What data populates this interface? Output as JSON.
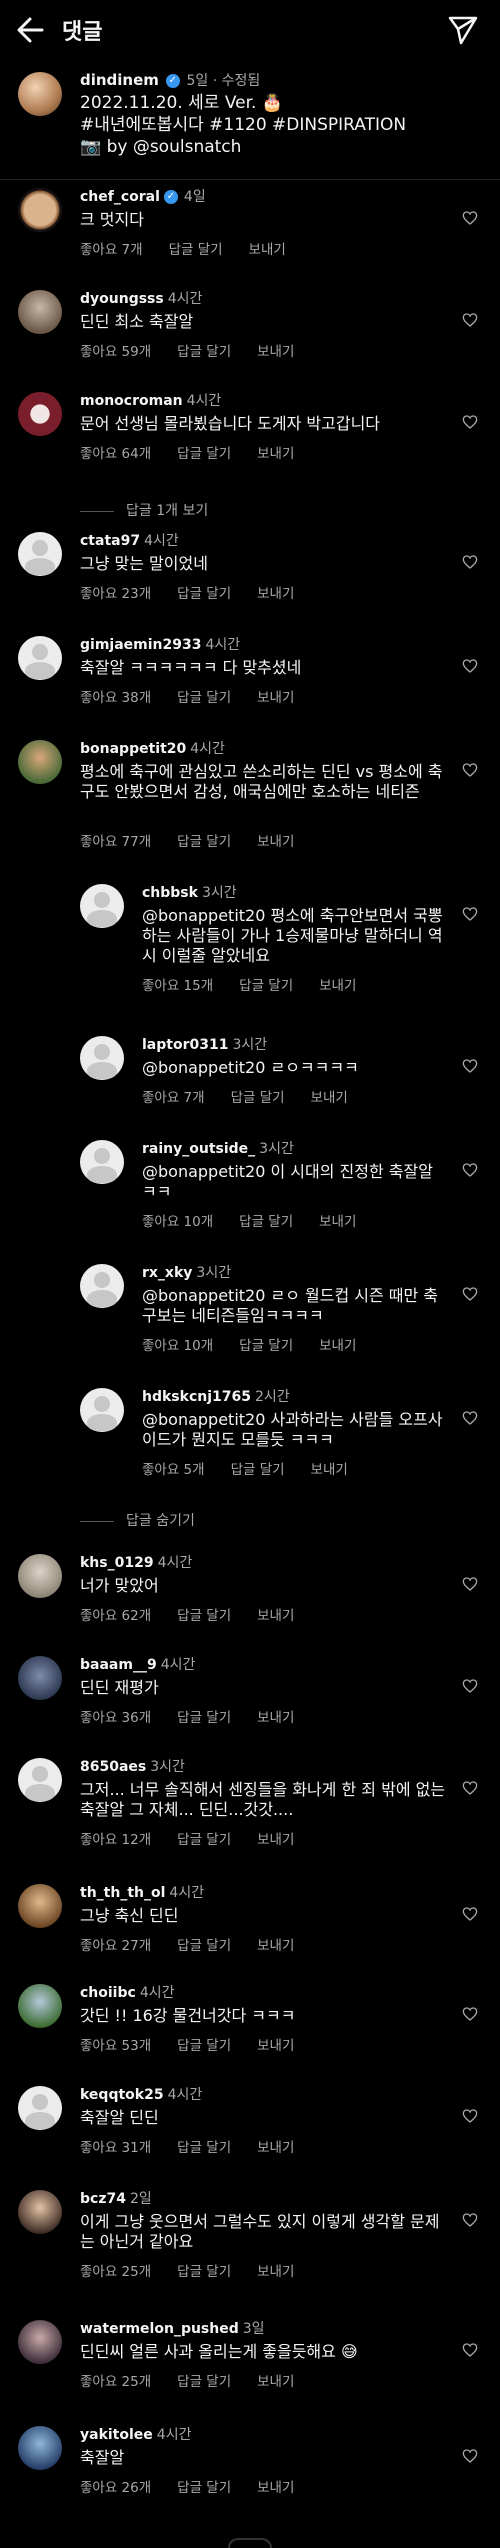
{
  "header": {
    "title": "댓글"
  },
  "caption": {
    "username": "dindinem",
    "meta": "5일 · 수정됨",
    "body": "2022.11.20. 세로 Ver. 🎂\n#내년에또봅시다 #1120 #DINSPIRATION\n📷 by @soulsnatch"
  },
  "actions": {
    "like_reply": "답글 달기",
    "send": "보내기"
  },
  "comments": [
    {
      "user": "chef_coral",
      "verified": "✓",
      "time": "4일",
      "text": "크 멋지다",
      "likes": "좋아요 7개"
    },
    {
      "user": "dyoungsss",
      "time": "4시간",
      "text": "딘딘 최소 축잘알",
      "likes": "좋아요 59개"
    },
    {
      "user": "monocroman",
      "time": "4시간",
      "text": "문어 선생님 몰라뵜습니다 도게자 박고갑니다",
      "likes": "좋아요 64개",
      "more": "답글 1개 보기"
    },
    {
      "user": "ctata97",
      "time": "4시간",
      "text": "그냥 맞는 말이었네",
      "likes": "좋아요 23개"
    },
    {
      "user": "gimjaemin2933",
      "time": "4시간",
      "text": "축잘알 ㅋㅋㅋㅋㅋㅋ 다 맞추셨네",
      "likes": "좋아요 38개"
    },
    {
      "user": "bonappetit20",
      "time": "4시간",
      "text": "평소에 축구에 관심있고 쓴소리하는 딘딘 vs 평소에 축구도 안봤으면서 감성, 애국심에만 호소하는 네티즌",
      "likes": "좋아요 77개"
    },
    {
      "user": "chbbsk",
      "time": "3시간",
      "text": "@bonappetit20 평소에 축구안보면서 국뽕하는 사람들이 가나 1승제물마냥 말하더니 역시 이럴줄 알았네요",
      "likes": "좋아요 15개"
    },
    {
      "user": "laptor0311",
      "time": "3시간",
      "text": "@bonappetit20 ㄹㅇㅋㅋㅋㅋ",
      "likes": "좋아요 7개"
    },
    {
      "user": "rainy_outside_",
      "time": "3시간",
      "text": "@bonappetit20 이 시대의 진정한 축잘알 ㅋㅋ",
      "likes": "좋아요 10개"
    },
    {
      "user": "rx_xky",
      "time": "3시간",
      "text": "@bonappetit20 ㄹㅇ 월드컵 시즌 때만 축구보는 네티즌들임ㅋㅋㅋㅋ",
      "likes": "좋아요 10개"
    },
    {
      "user": "hdkskcnj1765",
      "time": "2시간",
      "text": "@bonappetit20 사과하라는 사람들 오프사이드가 뭔지도 모를듯 ㅋㅋㅋ",
      "likes": "좋아요 5개",
      "more": "답글 숨기기"
    },
    {
      "user": "khs_0129",
      "time": "4시간",
      "text": "너가 맞았어",
      "likes": "좋아요 62개"
    },
    {
      "user": "baaam__9",
      "time": "4시간",
      "text": "딘딘 재평가",
      "likes": "좋아요 36개"
    },
    {
      "user": "8650aes",
      "time": "3시간",
      "text": "그저... 너무 솔직해서 센징들을 화나게 한 죄 밖에 없는 축잘알 그 자체... 딘딘...갓갓....",
      "likes": "좋아요 12개"
    },
    {
      "user": "th_th_th_ol",
      "time": "4시간",
      "text": "그냥 축신 딘딘",
      "likes": "좋아요 27개"
    },
    {
      "user": "choiibc",
      "time": "4시간",
      "text": "갓딘 !! 16강 물건너갓다 ㅋㅋㅋ",
      "likes": "좋아요 53개"
    },
    {
      "user": "keqqtok25",
      "time": "4시간",
      "text": "축잘알 딘딘",
      "likes": "좋아요 31개"
    },
    {
      "user": "bcz74",
      "time": "2일",
      "text": "이게 그냥 웃으면서 그럴수도 있지 이렇게 생각할 문제는 아닌거 같아요",
      "likes": "좋아요 25개"
    },
    {
      "user": "watermelon_pushed",
      "time": "3일",
      "text": "딘딘씨 얼른 사과 올리는게 좋을듯해요 😅",
      "likes": "좋아요 25개"
    },
    {
      "user": "yakitolee",
      "time": "4시간",
      "text": "축잘알",
      "likes": "좋아요 26개"
    }
  ]
}
